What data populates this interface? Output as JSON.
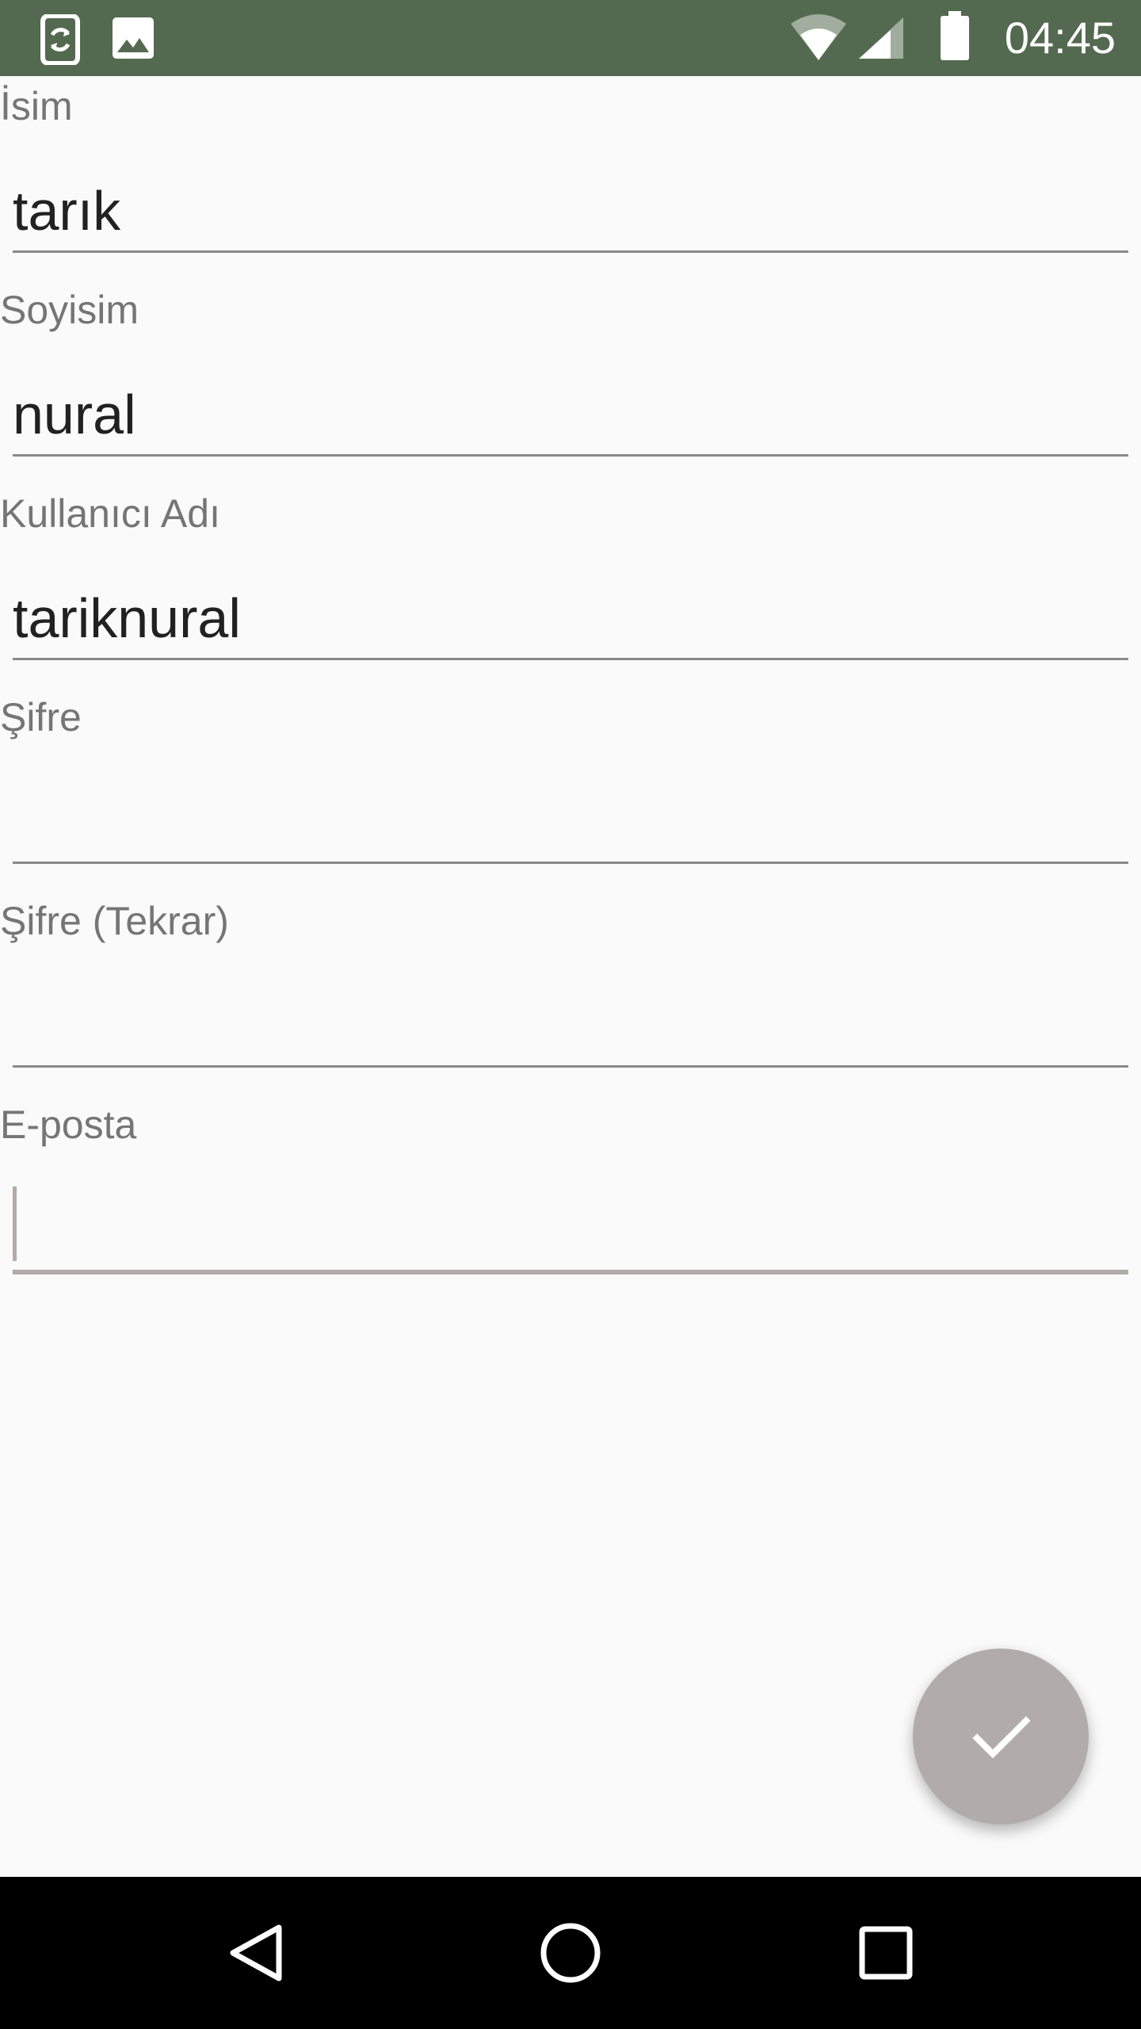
{
  "status_bar": {
    "time": "04:45",
    "icons": [
      "screen-rotation-icon",
      "image-icon",
      "wifi-icon",
      "signal-icon",
      "battery-icon"
    ],
    "background_color": "#546a50"
  },
  "form": {
    "fields": [
      {
        "label": "İsim",
        "value": "tarık"
      },
      {
        "label": "Soyisim",
        "value": "nural"
      },
      {
        "label": "Kullanıcı Adı",
        "value": "tariknural"
      },
      {
        "label": "Şifre",
        "value": ""
      },
      {
        "label": "Şifre (Tekrar)",
        "value": ""
      },
      {
        "label": "E-posta",
        "value": ""
      }
    ]
  },
  "fab": {
    "icon": "check-icon",
    "color": "#b2abab"
  },
  "nav_bar": {
    "icons": [
      "back-icon",
      "home-icon",
      "recents-icon"
    ]
  }
}
